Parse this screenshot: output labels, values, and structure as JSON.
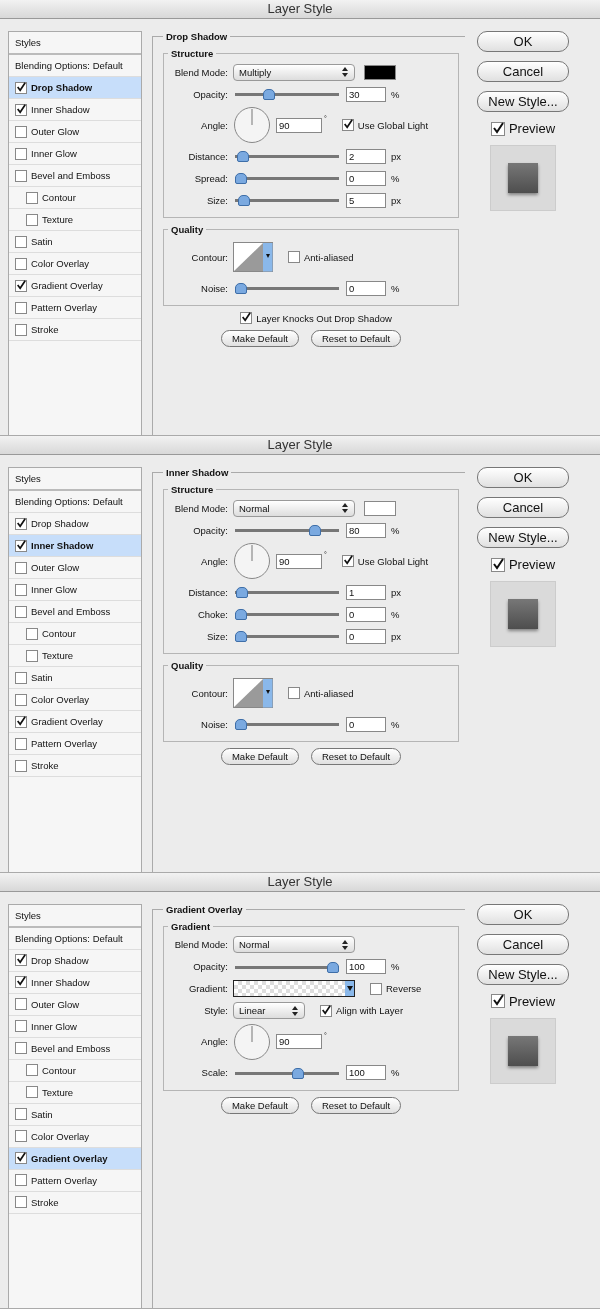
{
  "dialogs": [
    {
      "title": "Layer Style",
      "styles": [
        {
          "kind": "header",
          "label": "Styles",
          "selected": false
        },
        {
          "kind": "option",
          "label": "Blending Options: Default",
          "selected": false
        },
        {
          "kind": "check",
          "label": "Drop Shadow",
          "checked": true,
          "selected": true
        },
        {
          "kind": "check",
          "label": "Inner Shadow",
          "checked": true,
          "selected": false
        },
        {
          "kind": "check",
          "label": "Outer Glow",
          "checked": false,
          "selected": false
        },
        {
          "kind": "check",
          "label": "Inner Glow",
          "checked": false,
          "selected": false
        },
        {
          "kind": "check",
          "label": "Bevel and Emboss",
          "checked": false,
          "selected": false,
          "children": [
            {
              "kind": "check",
              "label": "Contour",
              "checked": false,
              "selected": false
            },
            {
              "kind": "check",
              "label": "Texture",
              "checked": false,
              "selected": false
            }
          ]
        },
        {
          "kind": "check",
          "label": "Satin",
          "checked": false,
          "selected": false
        },
        {
          "kind": "check",
          "label": "Color Overlay",
          "checked": false,
          "selected": false
        },
        {
          "kind": "check",
          "label": "Gradient Overlay",
          "checked": true,
          "selected": false
        },
        {
          "kind": "check",
          "label": "Pattern Overlay",
          "checked": false,
          "selected": false
        },
        {
          "kind": "check",
          "label": "Stroke",
          "checked": false,
          "selected": false
        }
      ],
      "panel": {
        "title": "Drop Shadow",
        "sections": [
          {
            "title": "Structure",
            "rows": [
              {
                "kind": "select",
                "label": "Blend Mode:",
                "value": "Multiply",
                "color": "#000000"
              },
              {
                "kind": "slider",
                "label": "Opacity:",
                "level": 0.3,
                "value": "30",
                "unit": "%"
              },
              {
                "kind": "angle",
                "label": "Angle:",
                "value": "90",
                "unit": "°",
                "check": {
                  "label": "Use Global Light",
                  "checked": true
                }
              },
              {
                "kind": "slider",
                "label": "Distance:",
                "level": 0.02,
                "value": "2",
                "unit": "px"
              },
              {
                "kind": "slider",
                "label": "Spread:",
                "level": 0,
                "value": "0",
                "unit": "%"
              },
              {
                "kind": "slider",
                "label": "Size:",
                "level": 0.03,
                "value": "5",
                "unit": "px"
              }
            ]
          },
          {
            "title": "Quality",
            "rows": [
              {
                "kind": "contour",
                "label": "Contour:",
                "check": {
                  "label": "Anti-aliased",
                  "checked": false
                }
              },
              {
                "kind": "slider",
                "label": "Noise:",
                "level": 0,
                "value": "0",
                "unit": "%"
              }
            ]
          }
        ],
        "checks": [
          {
            "label": "Layer Knocks Out Drop Shadow",
            "checked": true
          }
        ],
        "buttons": [
          "Make Default",
          "Reset to Default"
        ]
      },
      "actions": [
        "OK",
        "Cancel",
        "New Style..."
      ],
      "preview": {
        "label": "Preview",
        "checked": true
      }
    },
    {
      "title": "Layer Style",
      "styles": [
        {
          "kind": "header",
          "label": "Styles",
          "selected": false
        },
        {
          "kind": "option",
          "label": "Blending Options: Default",
          "selected": false
        },
        {
          "kind": "check",
          "label": "Drop Shadow",
          "checked": true,
          "selected": false
        },
        {
          "kind": "check",
          "label": "Inner Shadow",
          "checked": true,
          "selected": true
        },
        {
          "kind": "check",
          "label": "Outer Glow",
          "checked": false,
          "selected": false
        },
        {
          "kind": "check",
          "label": "Inner Glow",
          "checked": false,
          "selected": false
        },
        {
          "kind": "check",
          "label": "Bevel and Emboss",
          "checked": false,
          "selected": false,
          "children": [
            {
              "kind": "check",
              "label": "Contour",
              "checked": false,
              "selected": false
            },
            {
              "kind": "check",
              "label": "Texture",
              "checked": false,
              "selected": false
            }
          ]
        },
        {
          "kind": "check",
          "label": "Satin",
          "checked": false,
          "selected": false
        },
        {
          "kind": "check",
          "label": "Color Overlay",
          "checked": false,
          "selected": false
        },
        {
          "kind": "check",
          "label": "Gradient Overlay",
          "checked": true,
          "selected": false
        },
        {
          "kind": "check",
          "label": "Pattern Overlay",
          "checked": false,
          "selected": false
        },
        {
          "kind": "check",
          "label": "Stroke",
          "checked": false,
          "selected": false
        }
      ],
      "panel": {
        "title": "Inner Shadow",
        "sections": [
          {
            "title": "Structure",
            "rows": [
              {
                "kind": "select",
                "label": "Blend Mode:",
                "value": "Normal",
                "color": "#ffffff"
              },
              {
                "kind": "slider",
                "label": "Opacity:",
                "level": 0.8,
                "value": "80",
                "unit": "%"
              },
              {
                "kind": "angle",
                "label": "Angle:",
                "value": "90",
                "unit": "°",
                "check": {
                  "label": "Use Global Light",
                  "checked": true
                }
              },
              {
                "kind": "slider",
                "label": "Distance:",
                "level": 0.01,
                "value": "1",
                "unit": "px"
              },
              {
                "kind": "slider",
                "label": "Choke:",
                "level": 0,
                "value": "0",
                "unit": "%"
              },
              {
                "kind": "slider",
                "label": "Size:",
                "level": 0,
                "value": "0",
                "unit": "px"
              }
            ]
          },
          {
            "title": "Quality",
            "rows": [
              {
                "kind": "contour",
                "label": "Contour:",
                "check": {
                  "label": "Anti-aliased",
                  "checked": false
                }
              },
              {
                "kind": "slider",
                "label": "Noise:",
                "level": 0,
                "value": "0",
                "unit": "%"
              }
            ]
          }
        ],
        "buttons": [
          "Make Default",
          "Reset to Default"
        ]
      },
      "actions": [
        "OK",
        "Cancel",
        "New Style..."
      ],
      "preview": {
        "label": "Preview",
        "checked": true
      }
    },
    {
      "title": "Layer Style",
      "styles": [
        {
          "kind": "header",
          "label": "Styles",
          "selected": false
        },
        {
          "kind": "option",
          "label": "Blending Options: Default",
          "selected": false
        },
        {
          "kind": "check",
          "label": "Drop Shadow",
          "checked": true,
          "selected": false
        },
        {
          "kind": "check",
          "label": "Inner Shadow",
          "checked": true,
          "selected": false
        },
        {
          "kind": "check",
          "label": "Outer Glow",
          "checked": false,
          "selected": false
        },
        {
          "kind": "check",
          "label": "Inner Glow",
          "checked": false,
          "selected": false
        },
        {
          "kind": "check",
          "label": "Bevel and Emboss",
          "checked": false,
          "selected": false,
          "children": [
            {
              "kind": "check",
              "label": "Contour",
              "checked": false,
              "selected": false
            },
            {
              "kind": "check",
              "label": "Texture",
              "checked": false,
              "selected": false
            }
          ]
        },
        {
          "kind": "check",
          "label": "Satin",
          "checked": false,
          "selected": false
        },
        {
          "kind": "check",
          "label": "Color Overlay",
          "checked": false,
          "selected": false
        },
        {
          "kind": "check",
          "label": "Gradient Overlay",
          "checked": true,
          "selected": true
        },
        {
          "kind": "check",
          "label": "Pattern Overlay",
          "checked": false,
          "selected": false
        },
        {
          "kind": "check",
          "label": "Stroke",
          "checked": false,
          "selected": false
        }
      ],
      "panel": {
        "title": "Gradient Overlay",
        "sections": [
          {
            "title": "Gradient",
            "rows": [
              {
                "kind": "select",
                "label": "Blend Mode:",
                "value": "Normal"
              },
              {
                "kind": "slider",
                "label": "Opacity:",
                "level": 1,
                "value": "100",
                "unit": "%"
              },
              {
                "kind": "gradient",
                "label": "Gradient:",
                "check": {
                  "label": "Reverse",
                  "checked": false
                }
              },
              {
                "kind": "select",
                "label": "Style:",
                "value": "Linear",
                "check": {
                  "label": "Align with Layer",
                  "checked": true
                }
              },
              {
                "kind": "angle",
                "label": "Angle:",
                "value": "90",
                "unit": "°"
              },
              {
                "kind": "slider",
                "label": "Scale:",
                "level": 0.62,
                "value": "100",
                "unit": "%"
              }
            ]
          }
        ],
        "buttons": [
          "Make Default",
          "Reset to Default"
        ]
      },
      "actions": [
        "OK",
        "Cancel",
        "New Style..."
      ],
      "preview": {
        "label": "Preview",
        "checked": true
      }
    }
  ]
}
